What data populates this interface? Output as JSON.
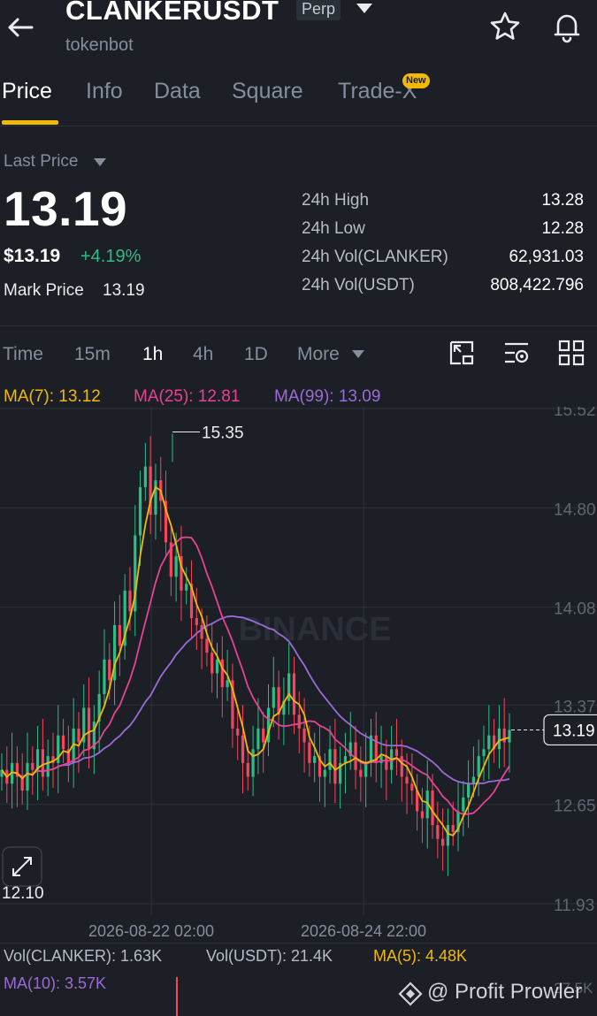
{
  "header": {
    "symbol": "CLANKERUSDT",
    "contract_type": "Perp",
    "subtitle": "tokenbot"
  },
  "tabs": [
    {
      "label": "Price",
      "active": true
    },
    {
      "label": "Info",
      "active": false
    },
    {
      "label": "Data",
      "active": false
    },
    {
      "label": "Square",
      "active": false
    },
    {
      "label": "Trade-X",
      "active": false,
      "badge": "New"
    }
  ],
  "price": {
    "selector_label": "Last Price",
    "last": "13.19",
    "usd": "$13.19",
    "change": "+4.19%",
    "mark_label": "Mark Price",
    "mark_value": "13.19"
  },
  "stats": [
    {
      "label": "24h High",
      "value": "13.28"
    },
    {
      "label": "24h Low",
      "value": "12.28"
    },
    {
      "label": "24h Vol(CLANKER)",
      "value": "62,931.03"
    },
    {
      "label": "24h Vol(USDT)",
      "value": "808,422.796"
    }
  ],
  "intervals": [
    {
      "label": "Time",
      "active": false
    },
    {
      "label": "15m",
      "active": false
    },
    {
      "label": "1h",
      "active": true
    },
    {
      "label": "4h",
      "active": false
    },
    {
      "label": "1D",
      "active": false
    },
    {
      "label": "More",
      "active": false
    }
  ],
  "moving_averages": [
    {
      "label": "MA(7): 13.12",
      "color": "#f0b90b"
    },
    {
      "label": "MA(25): 12.81",
      "color": "#e84393"
    },
    {
      "label": "MA(99): 13.09",
      "color": "#9b6bd6"
    }
  ],
  "chart_data": {
    "type": "candlestick",
    "y_ticks": [
      "15.52",
      "14.80",
      "14.08",
      "13.37",
      "12.65",
      "11.93"
    ],
    "x_ticks": [
      "2026-08-22 02:00",
      "2026-08-24 22:00"
    ],
    "high_marker": "15.35",
    "low_marker": "12.10",
    "current_price_label": "13.19",
    "watermark": "BINANCE",
    "colors": {
      "up": "#2ebd85",
      "down": "#f6465d",
      "ma7": "#f0b90b",
      "ma25": "#e84393",
      "ma99": "#9b6bd6"
    }
  },
  "volume": {
    "vol_base": "Vol(CLANKER): 1.63K",
    "vol_quote": "Vol(USDT): 21.4K",
    "ma5": "MA(5): 4.48K",
    "ma10": "MA(10): 3.57K",
    "axis_label": "27.5K"
  },
  "watermark_text": "@ Profit Prowler"
}
